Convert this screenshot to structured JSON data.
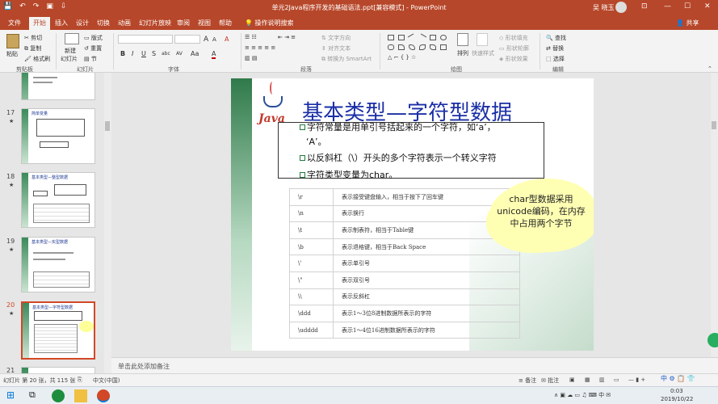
{
  "window": {
    "title": "单元2Java程序开发的基础语法.ppt[兼容模式] - PowerPoint",
    "user": "吴 晓玉",
    "controls": [
      "⊡",
      "—",
      "☐",
      "✕"
    ]
  },
  "quick_access": [
    "💾",
    "↶",
    "↷",
    "▣",
    "⇩"
  ],
  "tabs": [
    {
      "label": "文件"
    },
    {
      "label": "开始"
    },
    {
      "label": "插入"
    },
    {
      "label": "设计"
    },
    {
      "label": "切换"
    },
    {
      "label": "动画"
    },
    {
      "label": "幻灯片放映"
    },
    {
      "label": "审阅"
    },
    {
      "label": "视图"
    },
    {
      "label": "帮助"
    }
  ],
  "tell_me": "操作说明搜索",
  "share": "共享",
  "ribbon": {
    "clipboard": {
      "paste": "粘贴",
      "cut": "剪切",
      "copy": "复制",
      "format_painter": "格式刷",
      "group": "剪贴板"
    },
    "slides": {
      "new_slide": "新建",
      "new_slide2": "幻灯片",
      "layout": "版式",
      "reset": "重置",
      "section": "节",
      "group": "幻灯片"
    },
    "font": {
      "group": "字体",
      "grow": "A",
      "shrink": "A",
      "clear": "A",
      "bold": "B",
      "italic": "I",
      "underline": "U",
      "strike": "S",
      "shadow": "abc",
      "spacing": "AV",
      "case": "Aa",
      "color": "A"
    },
    "paragraph": {
      "group": "段落",
      "text_direction": "文字方向",
      "align_text": "对齐文本",
      "smartart": "转换为 SmartArt"
    },
    "drawing": {
      "group": "绘图",
      "arrange": "排列",
      "quick_styles": "快速样式",
      "fill": "形状填充",
      "outline": "形状轮廓",
      "effects": "形状效果"
    },
    "editing": {
      "group": "编辑",
      "find": "查找",
      "replace": "替换",
      "select": "选择"
    }
  },
  "thumbnails": [
    {
      "num": "17",
      "star": "★",
      "title": "简单变量"
    },
    {
      "num": "18",
      "star": "★",
      "title": "基本类型—整型数据"
    },
    {
      "num": "19",
      "star": "★",
      "title": "基本类型—实型数据"
    },
    {
      "num": "20",
      "star": "★",
      "title": "基本类型—字符型数据",
      "selected": true
    },
    {
      "num": "21",
      "star": "★",
      "title": ""
    }
  ],
  "slide": {
    "logo_text": "Java",
    "title": "基本类型—字符型数据",
    "bullets": [
      "字符常量是用单引号括起来的一个字符，如‘a’，",
      "‘A’。",
      "以反斜杠（\\）开头的多个字符表示一个转义字符",
      "字符类型变量为char。"
    ],
    "table": [
      [
        "\\r",
        "表示接受键盘输入，相当于按下了回车键"
      ],
      [
        "\\n",
        "表示换行"
      ],
      [
        "\\t",
        "表示制表符，相当于Table键"
      ],
      [
        "\\b",
        "表示退格键，相当于Back Space"
      ],
      [
        "\\'",
        "表示单引号"
      ],
      [
        "\\\"",
        "表示双引号"
      ],
      [
        "\\\\",
        "表示反斜杠"
      ],
      [
        "\\ddd",
        "表示1～3位8进制数据所表示的字符"
      ],
      [
        "\\udddd",
        "表示1～4位16进制数据所表示的字符"
      ]
    ],
    "callout": "char型数据采用unicode编码，在内存中占用两个字节"
  },
  "notes_placeholder": "单击此处添加备注",
  "status": {
    "slide_info": "幻灯片 第 20 张，共 115 张",
    "language": "中文(中国)",
    "notes": "备注",
    "comments": "批注",
    "zoom": "—"
  },
  "taskbar": {
    "time": "0:03",
    "date": "2019/10/22",
    "ime": "中"
  }
}
